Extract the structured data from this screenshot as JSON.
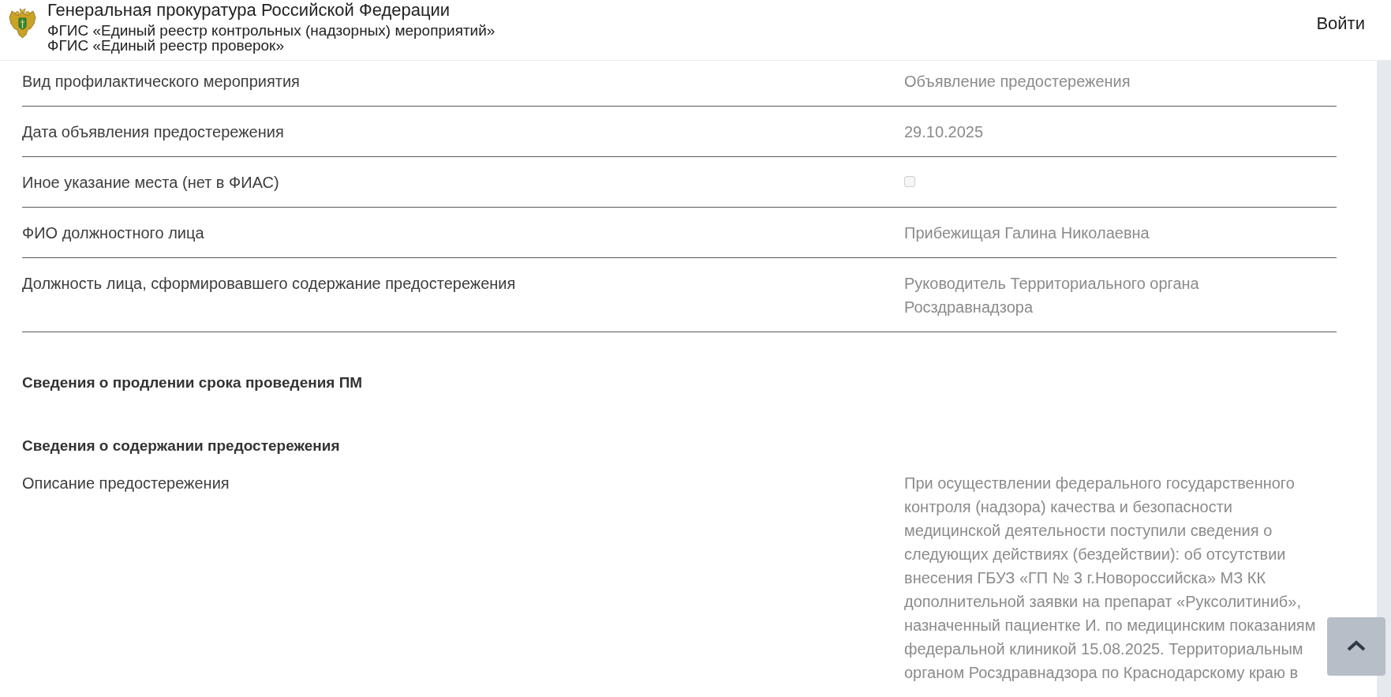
{
  "header": {
    "title": "Генеральная прокуратура Российской Федерации",
    "subtitles": [
      "ФГИС «Единый реестр контрольных (надзорных) мероприятий»",
      "ФГИС «Единый реестр проверок»"
    ],
    "login": "Войти"
  },
  "fields": [
    {
      "kind": "text",
      "label": "Вид профилактического мероприятия",
      "value": "Объявление предостережения"
    },
    {
      "kind": "text",
      "label": "Дата объявления предостережения",
      "value": "29.10.2025"
    },
    {
      "kind": "checkbox",
      "label": "Иное указание места (нет в ФИАС)",
      "checked": false
    },
    {
      "kind": "text",
      "label": "ФИО должностного лица",
      "value": "Прибежищая Галина Николаевна"
    },
    {
      "kind": "text",
      "label": "Должность лица, сформировавшего содержание предостережения",
      "lines": [
        "Руководитель Территориального органа",
        "Росздравнадзора"
      ]
    }
  ],
  "sections": [
    {
      "heading": "Сведения о продлении срока проведения ПМ"
    },
    {
      "heading": "Сведения о содержании предостережения",
      "fields": [
        {
          "kind": "text",
          "label": "Описание предостережения",
          "lines": [
            "При осуществлении федерального государственного",
            "контроля (надзора) качества и безопасности",
            "медицинской деятельности поступили сведения о",
            "следующих действиях (бездействии): об отсутствии",
            "внесения ГБУЗ «ГП № 3 г.Новороссийска» МЗ КК",
            "дополнительной заявки на препарат «Руксолитиниб»,",
            "назначенный пациентке И. по медицинским показаниям",
            "федеральной клиникой 15.08.2025. Территориальным",
            "органом Росздравнадзора по Краснодарскому краю в"
          ]
        }
      ]
    }
  ]
}
